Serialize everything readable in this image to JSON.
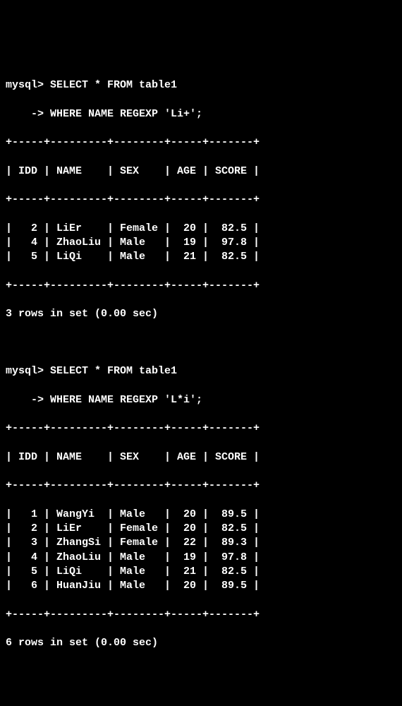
{
  "query1": {
    "prompt1": "mysql> ",
    "line1": "SELECT * FROM table1",
    "prompt2": "    -> ",
    "line2": "WHERE NAME REGEXP 'Li+';",
    "border": "+-----+---------+--------+-----+-------+",
    "headers": [
      "IDD",
      "NAME",
      "SEX",
      "AGE",
      "SCORE"
    ],
    "rows": [
      {
        "idd": 2,
        "name": "LiEr",
        "sex": "Female",
        "age": 20,
        "score": 82.5
      },
      {
        "idd": 4,
        "name": "ZhaoLiu",
        "sex": "Male",
        "age": 19,
        "score": 97.8
      },
      {
        "idd": 5,
        "name": "LiQi",
        "sex": "Male",
        "age": 21,
        "score": 82.5
      }
    ],
    "summary": "3 rows in set (0.00 sec)"
  },
  "query2": {
    "prompt1": "mysql> ",
    "line1": "SELECT * FROM table1",
    "prompt2": "    -> ",
    "line2": "WHERE NAME REGEXP 'L*i';",
    "border": "+-----+---------+--------+-----+-------+",
    "headers": [
      "IDD",
      "NAME",
      "SEX",
      "AGE",
      "SCORE"
    ],
    "rows": [
      {
        "idd": 1,
        "name": "WangYi",
        "sex": "Male",
        "age": 20,
        "score": 89.5
      },
      {
        "idd": 2,
        "name": "LiEr",
        "sex": "Female",
        "age": 20,
        "score": 82.5
      },
      {
        "idd": 3,
        "name": "ZhangSi",
        "sex": "Female",
        "age": 22,
        "score": 89.3
      },
      {
        "idd": 4,
        "name": "ZhaoLiu",
        "sex": "Male",
        "age": 19,
        "score": 97.8
      },
      {
        "idd": 5,
        "name": "LiQi",
        "sex": "Male",
        "age": 21,
        "score": 82.5
      },
      {
        "idd": 6,
        "name": "HuanJiu",
        "sex": "Male",
        "age": 20,
        "score": 89.5
      }
    ],
    "summary": "6 rows in set (0.00 sec)"
  },
  "chart_data": {
    "type": "table",
    "tables": [
      {
        "title": "SELECT * FROM table1 WHERE NAME REGEXP 'Li+'",
        "columns": [
          "IDD",
          "NAME",
          "SEX",
          "AGE",
          "SCORE"
        ],
        "rows": [
          [
            2,
            "LiEr",
            "Female",
            20,
            82.5
          ],
          [
            4,
            "ZhaoLiu",
            "Male",
            19,
            97.8
          ],
          [
            5,
            "LiQi",
            "Male",
            21,
            82.5
          ]
        ]
      },
      {
        "title": "SELECT * FROM table1 WHERE NAME REGEXP 'L*i'",
        "columns": [
          "IDD",
          "NAME",
          "SEX",
          "AGE",
          "SCORE"
        ],
        "rows": [
          [
            1,
            "WangYi",
            "Male",
            20,
            89.5
          ],
          [
            2,
            "LiEr",
            "Female",
            20,
            82.5
          ],
          [
            3,
            "ZhangSi",
            "Female",
            22,
            89.3
          ],
          [
            4,
            "ZhaoLiu",
            "Male",
            19,
            97.8
          ],
          [
            5,
            "LiQi",
            "Male",
            21,
            82.5
          ],
          [
            6,
            "HuanJiu",
            "Male",
            20,
            89.5
          ]
        ]
      }
    ]
  }
}
